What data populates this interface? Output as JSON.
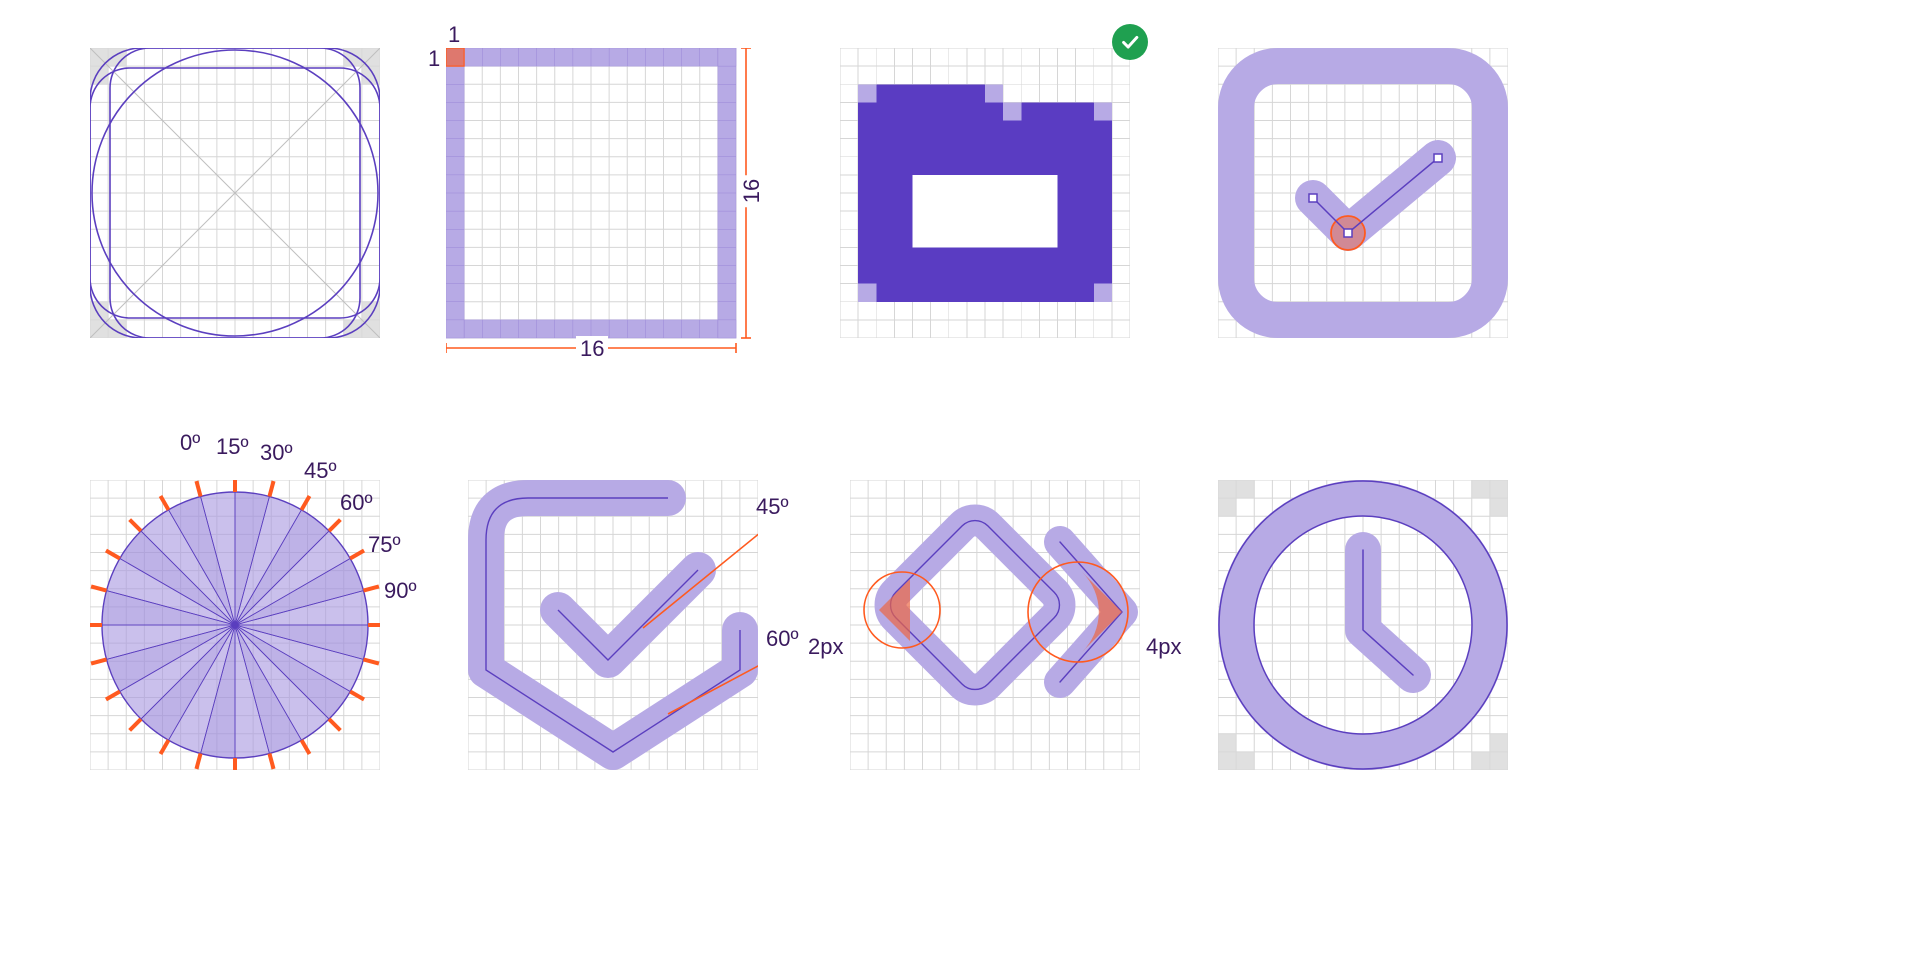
{
  "grid_dims": {
    "width": "16",
    "height": "16",
    "corner_x": "1",
    "corner_y": "1"
  },
  "status_badge": "correct",
  "angles": {
    "a0": "0º",
    "a15": "15º",
    "a30": "30º",
    "a45": "45º",
    "a60": "60º",
    "a75": "75º",
    "a90": "90º"
  },
  "shield_angles": {
    "top": "45º",
    "bottom": "60º"
  },
  "radii": {
    "small": "2px",
    "large": "4px"
  },
  "colors": {
    "purple_fill": "#b7aae5",
    "purple_stroke": "#5b3fbf",
    "purple_dark": "#5a3cc2",
    "orange": "#ff5a1f",
    "orange_fill": "#f08b63",
    "red_fill": "#eb6745",
    "grid_line": "#d6d6d6",
    "grid_line_dark": "#bfbfbf",
    "green": "#1fa050",
    "white": "#ffffff"
  },
  "diagram": {
    "rows": 2,
    "cols": 4,
    "cells": [
      "keyline-grid",
      "pixel-grid-dimensions",
      "pixel-folder",
      "checkbox-anchors",
      "angle-wheel",
      "shield-check-angles",
      "corner-radius-demo",
      "clock-keyline"
    ]
  }
}
